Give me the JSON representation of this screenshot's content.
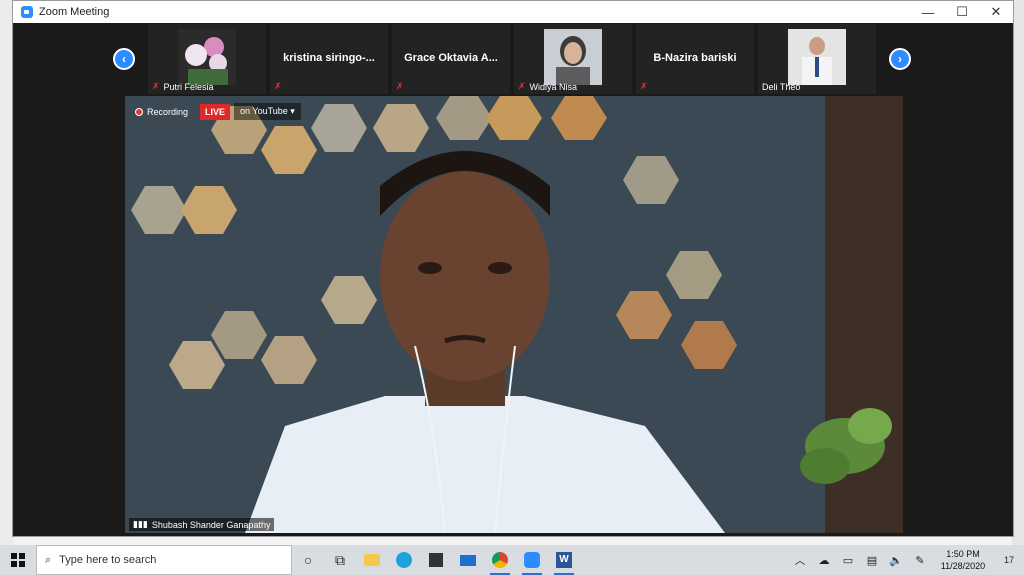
{
  "window": {
    "title": "Zoom Meeting",
    "minimize": "—",
    "maximize": "☐",
    "close": "✕"
  },
  "gallery": {
    "prev": "‹",
    "next": "›",
    "tiles": [
      {
        "name": "Putri Felesia",
        "center": ""
      },
      {
        "name": "",
        "center": "kristina  siringo-..."
      },
      {
        "name": "",
        "center": "Grace  Oktavia  A..."
      },
      {
        "name": "Widiya Nisa",
        "center": ""
      },
      {
        "name": "",
        "center": "B-Nazira bariski"
      },
      {
        "name": "Deli Theo",
        "center": ""
      }
    ]
  },
  "video": {
    "recording": "Recording",
    "live": "LIVE",
    "youtube": "on YouTube",
    "speaker": "Shubash Shander Ganapathy"
  },
  "taskbar": {
    "search_placeholder": "Type here to search",
    "time": "1:50 PM",
    "date": "11/28/2020",
    "notifications": "17"
  }
}
